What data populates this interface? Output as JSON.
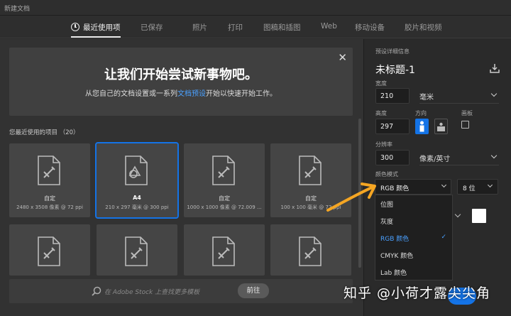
{
  "window": {
    "title": "新建文档"
  },
  "tabs": [
    {
      "label": "最近使用项",
      "active": true
    },
    {
      "label": "已保存"
    },
    {
      "label": "照片"
    },
    {
      "label": "打印"
    },
    {
      "label": "图稿和插图"
    },
    {
      "label": "Web"
    },
    {
      "label": "移动设备"
    },
    {
      "label": "胶片和视频"
    }
  ],
  "welcome": {
    "heading": "让我们开始尝试新事物吧。",
    "text_before": "从您自己的文档设置或一系列",
    "link": "文档预设",
    "text_after": "开始以快速开始工作。"
  },
  "recent": {
    "label": "您最近使用的项目 （20）",
    "items": [
      {
        "name": "自定",
        "desc": "2480 x 3508 像素 @ 72 ppi",
        "selected": false
      },
      {
        "name": "A4",
        "desc": "210 x 297 毫米 @ 300 ppi",
        "selected": true
      },
      {
        "name": "自定",
        "desc": "1000 x 1000 像素 @ 72.009 ...",
        "selected": false
      },
      {
        "name": "自定",
        "desc": "100 x 100 毫米 @ 72 ppi",
        "selected": false
      }
    ]
  },
  "search": {
    "placeholder": "在 Adobe Stock 上查找更多模板",
    "button": "前往"
  },
  "panel": {
    "section": "预设详细信息",
    "doc_title": "未标题-1",
    "width_label": "宽度",
    "width_value": "210",
    "width_unit": "毫米",
    "height_label": "高度",
    "height_value": "297",
    "orientation_label": "方向",
    "artboard_label": "画板",
    "resolution_label": "分辨率",
    "resolution_value": "300",
    "resolution_unit": "像素/英寸",
    "color_mode_label": "颜色模式",
    "color_mode_value": "RGB 颜色",
    "bit_depth": "8 位",
    "color_mode_options": [
      "位图",
      "灰度",
      "RGB 颜色",
      "CMYK 颜色",
      "Lab 颜色"
    ],
    "selected_option": "RGB 颜色"
  },
  "watermark": "知乎 @小荷才露尖尖角",
  "colors": {
    "accent": "#1473e6",
    "arrow": "#f5a623"
  }
}
